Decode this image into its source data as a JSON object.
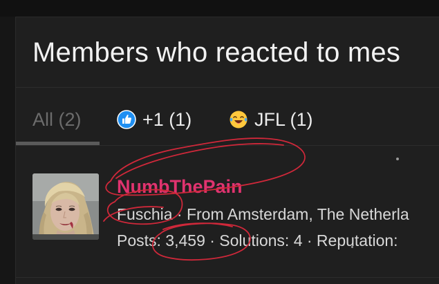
{
  "dialog": {
    "title": "Members who reacted to mes"
  },
  "tabs": [
    {
      "label": "All (2)",
      "icon": "none"
    },
    {
      "label": "+1 (1)",
      "icon": "thumbs-up-icon"
    },
    {
      "label": "JFL (1)",
      "icon": "laughing-crying-icon"
    }
  ],
  "member": {
    "username": "NumbThePain",
    "info_line": "Fuschia · From Amsterdam, The Netherla",
    "stats_line": "Posts: 3,459 · Solutions: 4 · Reputation:"
  },
  "colors": {
    "background": "#1f1f1f",
    "username": "#e0336f",
    "annotation": "#d0283a",
    "thumbs_up": "#1f8ff2",
    "emoji": "#ffc83d"
  }
}
